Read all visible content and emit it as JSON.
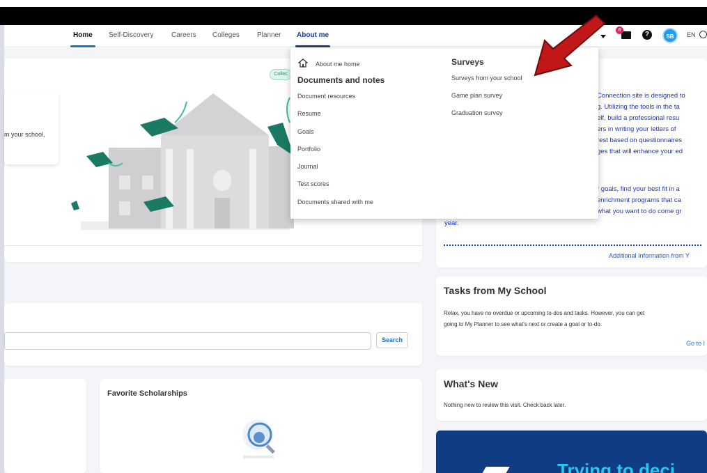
{
  "nav": {
    "items": [
      "Home",
      "Self-Discovery",
      "Careers",
      "Colleges",
      "Planner",
      "About me"
    ],
    "mail_badge": "8",
    "avatar_initials": "SB",
    "language": "EN"
  },
  "hero": {
    "note_text": "m your school,",
    "pill": "Collec"
  },
  "dropdown": {
    "about_me_home": "About me home",
    "documents_heading": "Documents and notes",
    "documents": [
      "Document resources",
      "Resume",
      "Goals",
      "Portfolio",
      "Journal",
      "Test scores",
      "Documents shared with me"
    ],
    "surveys_heading": "Surveys",
    "surveys": [
      "Surveys from your school",
      "Game plan survey",
      "Graduation survey"
    ]
  },
  "info": {
    "lines": [
      "Connection site is designed to",
      "g. Utilizing the tools in the ta",
      "elf, build a professional resu",
      "ers in writing your letters of",
      "rest based on questionnaires",
      "ges that will enhance your ed"
    ],
    "lines2": [
      "r goals, find your best fit in a",
      "enrichment programs that ca",
      "what you want to do come gr",
      "year."
    ],
    "link": "Additional Information from Y"
  },
  "search": {
    "button": "Search"
  },
  "favorites": {
    "title": "Favorite Scholarships"
  },
  "tasks": {
    "title": "Tasks from My School",
    "text_line1": "Relax, you have no overdue or upcoming to-dos and tasks. However, you can get",
    "text_line2": "going to My Planner to see what's next or create a goal or to-do.",
    "link": "Go to I"
  },
  "whats_new": {
    "title": "What's New",
    "text": "Nothing new to review this visit. Check back later."
  },
  "promo": {
    "text": "Trying to deci"
  },
  "colors": {
    "accent": "#1a6fd1",
    "nav_active": "#1b3d8f",
    "arrow": "#c01818",
    "info_text": "#1b33c8",
    "promo_bg": "#0f3c82"
  }
}
